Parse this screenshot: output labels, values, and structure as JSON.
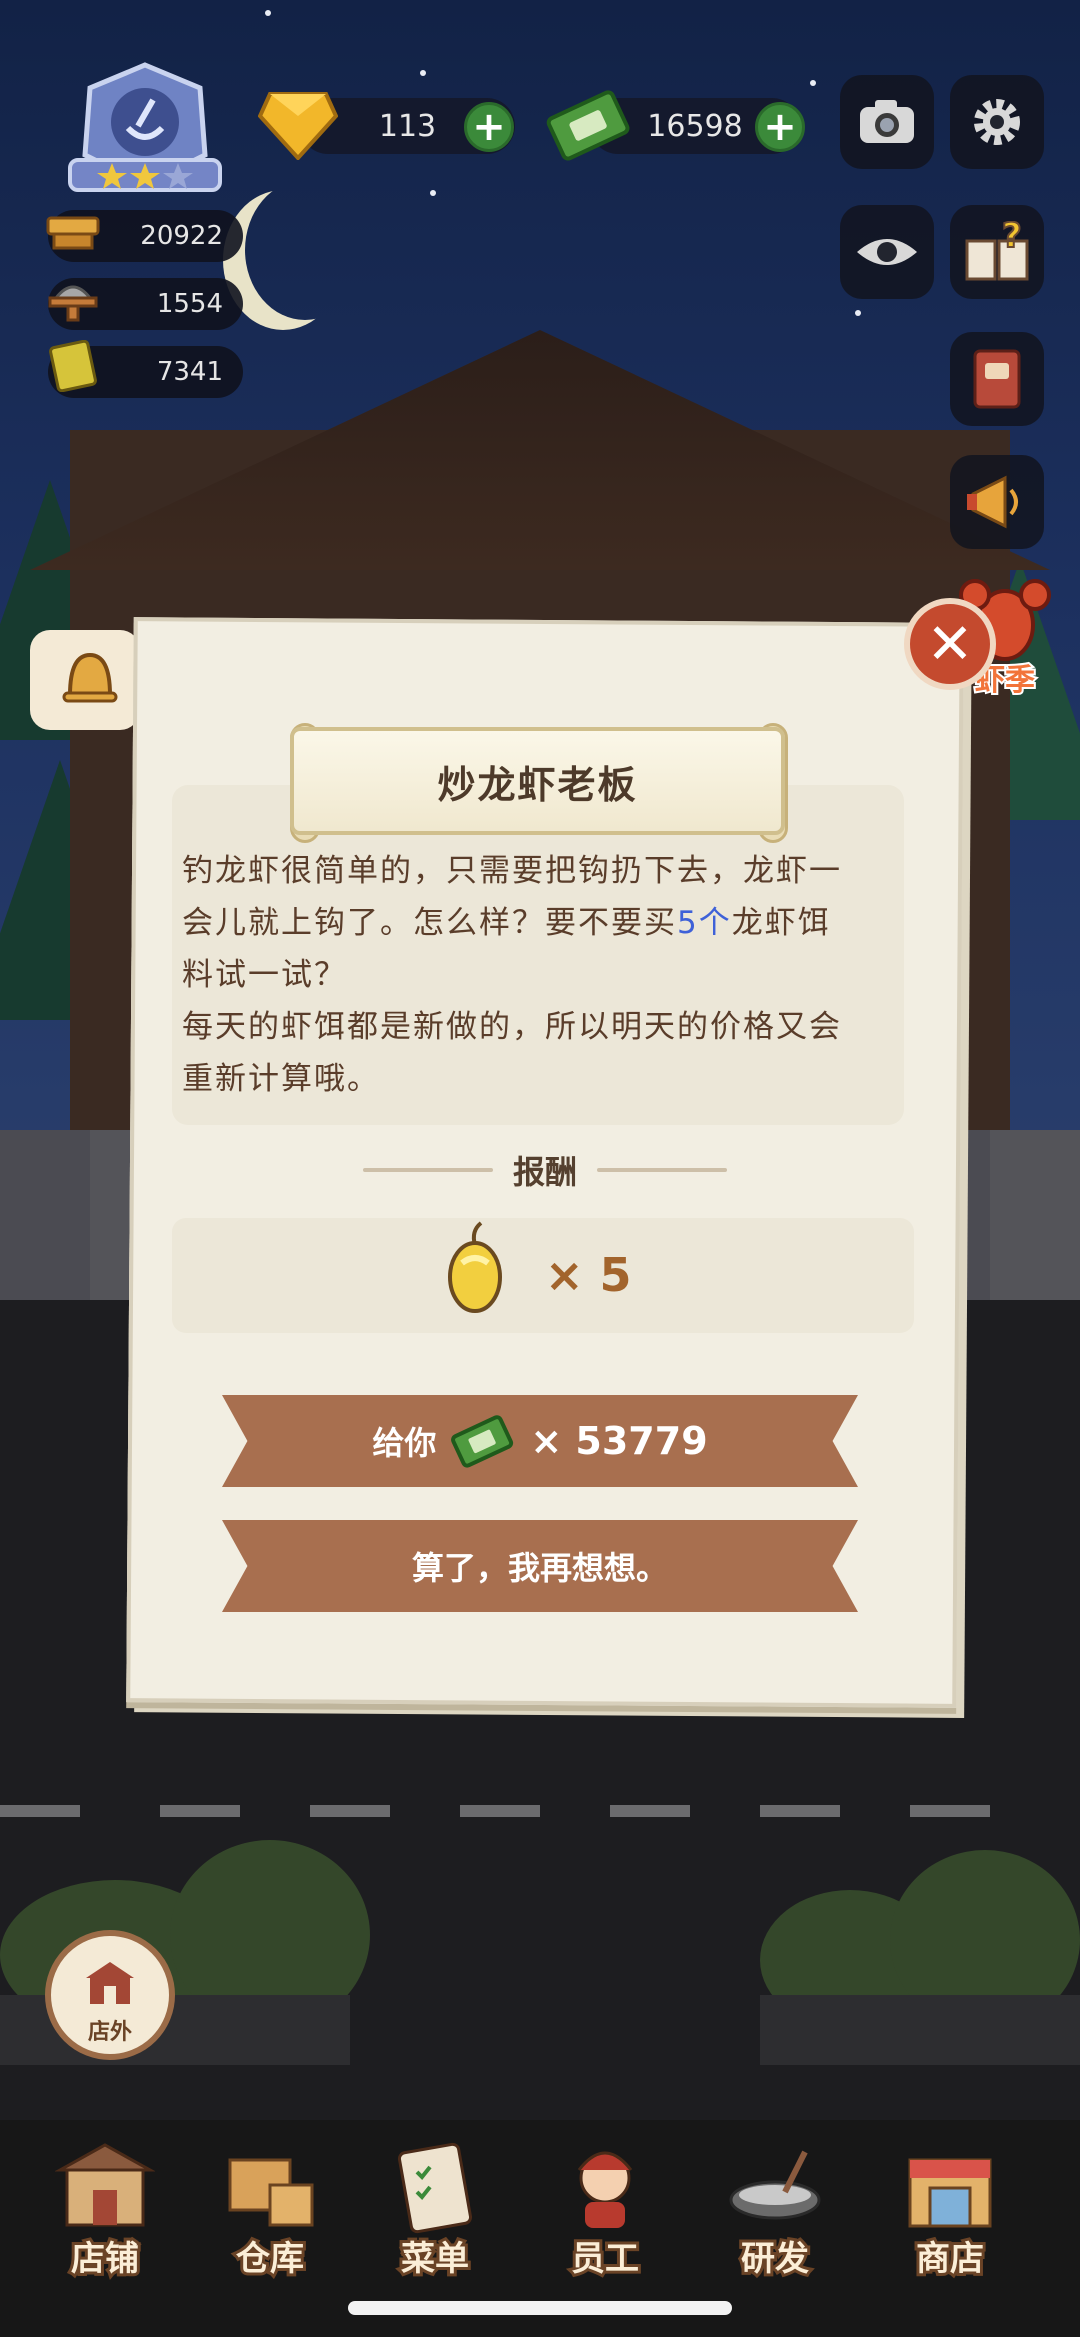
{
  "hud": {
    "gems": "113",
    "cash": "16598",
    "stats": [
      "20922",
      "1554",
      "7341"
    ]
  },
  "side_badge": "虾季",
  "dialog": {
    "title": "炒龙虾老板",
    "text_line1": "钓龙虾很简单的，只需要把钩扔下去，龙虾一",
    "text_line2a": "会儿就上钩了。怎么样？要不要买",
    "text_line2_highlight": "5个",
    "text_line2b": "龙虾饵",
    "text_line3": "料试一试？",
    "text_line4": "每天的虾饵都是新做的，所以明天的价格又会",
    "text_line5": "重新计算哦。",
    "reward_title": "报酬",
    "reward_qty": "× 5",
    "buy_label": "给你",
    "buy_amount": "× 53779",
    "decline_label": "算了，我再想想。",
    "close_symbol": "✕"
  },
  "outside_label": "店外",
  "nav": [
    "店铺",
    "仓库",
    "菜单",
    "员工",
    "研发",
    "商店"
  ],
  "colors": {
    "accent_btn": "#a86f4f",
    "close_btn": "#c44a2e",
    "highlight_text": "#3e61d8"
  }
}
